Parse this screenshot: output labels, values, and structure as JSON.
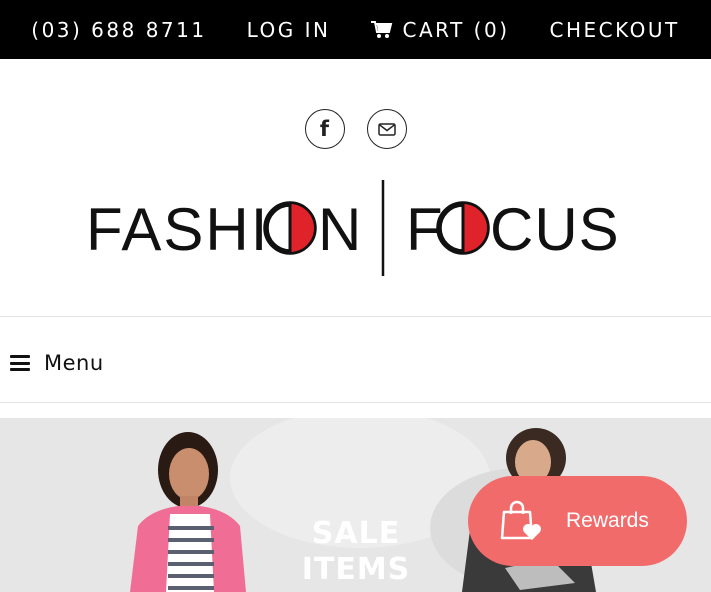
{
  "topbar": {
    "phone": "(03) 688 8711",
    "login": "LOG IN",
    "cart": "CART (0)",
    "checkout": "CHECKOUT"
  },
  "social": {
    "facebook_glyph": "f",
    "icons": [
      "facebook-icon",
      "email-icon"
    ]
  },
  "logo": {
    "left_word": "FASHION",
    "right_word": "FOCUS",
    "brand_red": "#e0232b"
  },
  "menu": {
    "label": "Menu"
  },
  "hero": {
    "line1": "SALE",
    "line2": "ITEMS"
  },
  "rewards": {
    "label": "Rewards",
    "color": "#f26b6b"
  }
}
